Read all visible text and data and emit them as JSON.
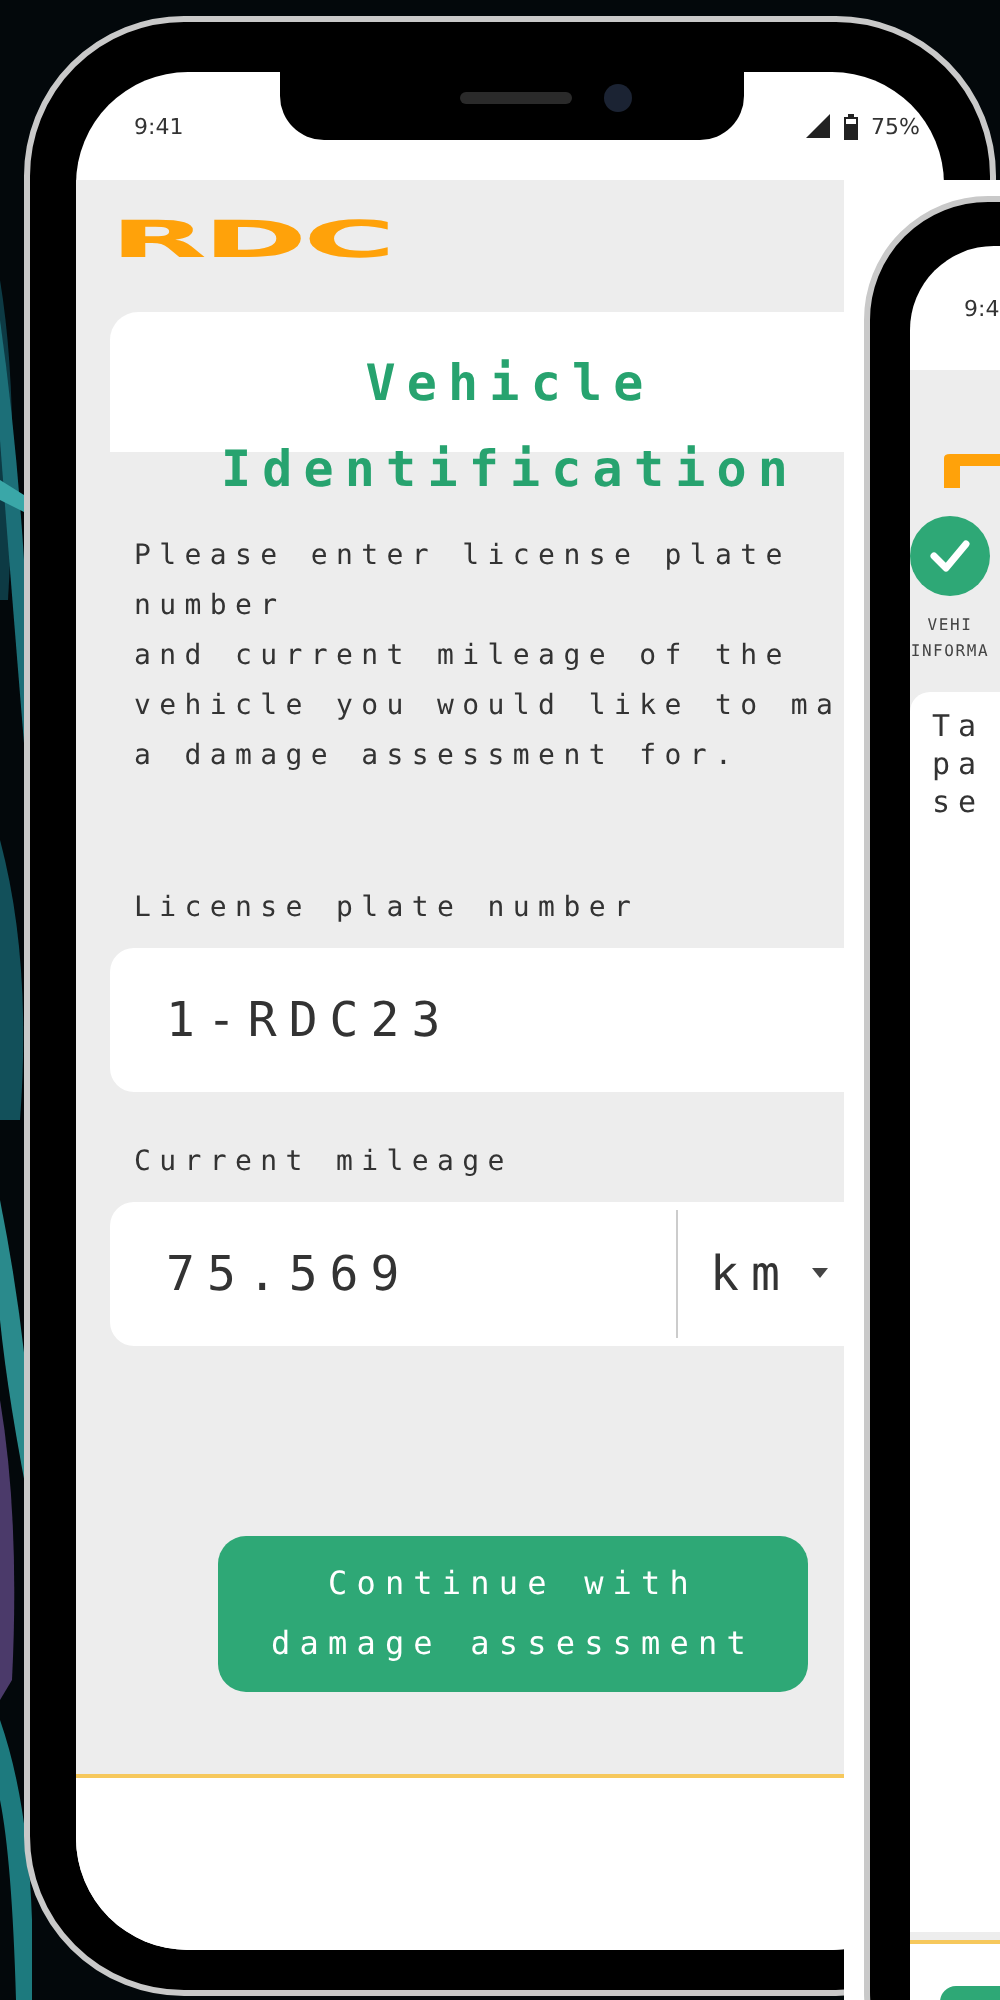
{
  "phone_1": {
    "status_bar": {
      "time": "9:41",
      "battery": "75%"
    },
    "logo": "RDC",
    "title": "Vehicle Identification",
    "description_lines": [
      "Please enter license plate",
      "number",
      "and current mileage of the",
      "vehicle you would like to ma",
      "a damage assessment for."
    ],
    "fields": [
      {
        "label": "License plate number",
        "value": "1-RDC23"
      },
      {
        "label": "Current mileage",
        "value": "75.569",
        "unit": "km"
      }
    ],
    "button": "Continue with damage assessment"
  },
  "phone_2": {
    "status_bar": {
      "time": "9:4"
    },
    "steps": [
      {
        "label_lines": [
          "VEHI",
          "INFORMA"
        ],
        "completed": true
      }
    ],
    "card_lines": [
      "Ta",
      "pa",
      "se"
    ]
  }
}
